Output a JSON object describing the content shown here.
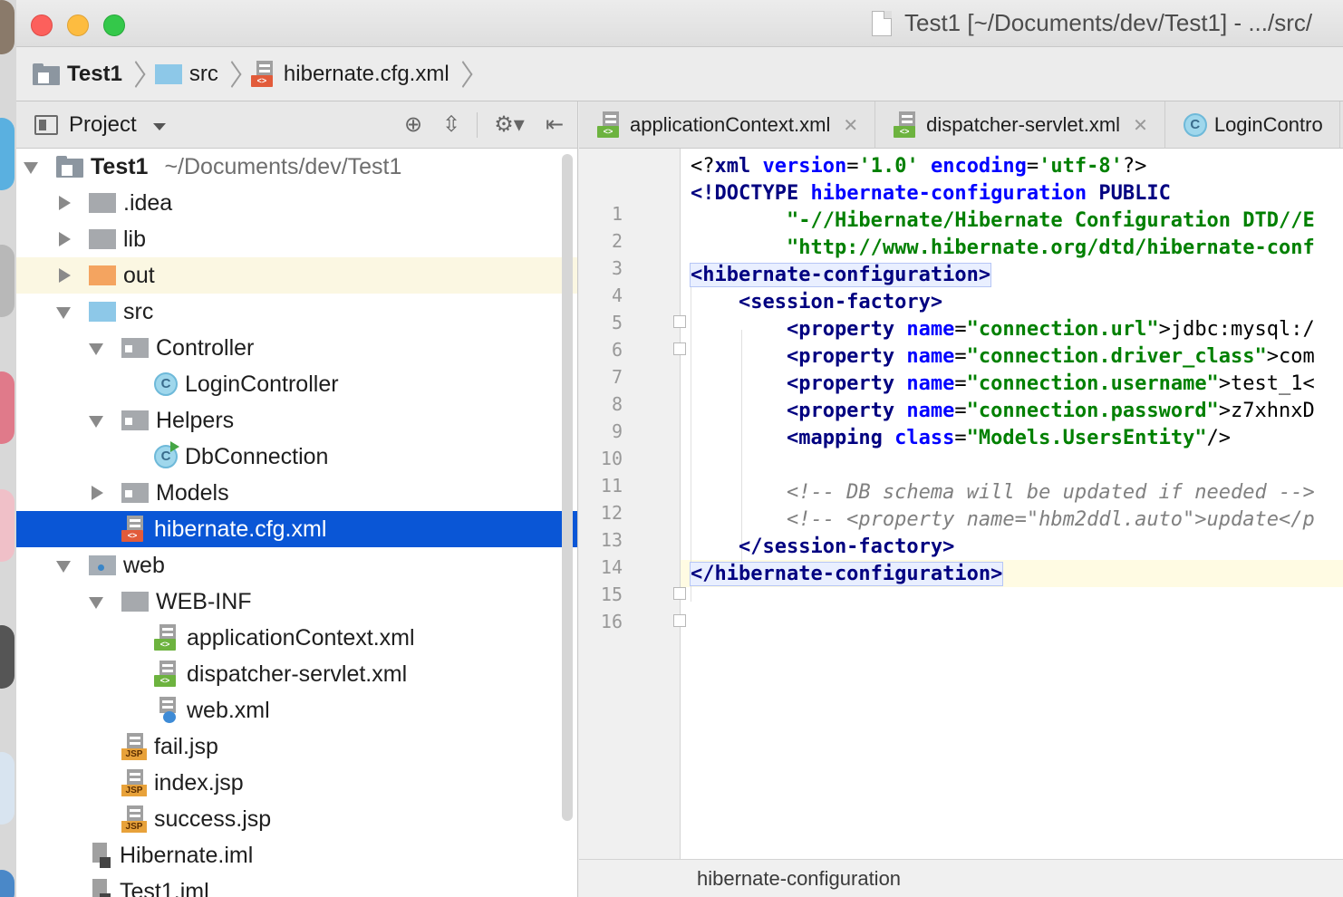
{
  "window": {
    "title": "Test1 [~/Documents/dev/Test1] - .../src/"
  },
  "breadcrumb": [
    {
      "label": "Test1",
      "icon": "module-icon"
    },
    {
      "label": "src",
      "icon": "folder-icon"
    },
    {
      "label": "hibernate.cfg.xml",
      "icon": "xml-file-icon"
    }
  ],
  "project_panel": {
    "title": "Project",
    "tools": [
      "locate-icon",
      "collapse-icon",
      "gear-icon",
      "hide-icon"
    ],
    "tree": [
      {
        "label": "Test1",
        "path": "~/Documents/dev/Test1",
        "depth": 0,
        "arrow": "down",
        "icon": "module"
      },
      {
        "label": ".idea",
        "depth": 1,
        "arrow": "right",
        "icon": "folder-gray"
      },
      {
        "label": "lib",
        "depth": 1,
        "arrow": "right",
        "icon": "folder-gray"
      },
      {
        "label": "out",
        "depth": 1,
        "arrow": "right",
        "icon": "folder-orange"
      },
      {
        "label": "src",
        "depth": 1,
        "arrow": "down",
        "icon": "folder-blue"
      },
      {
        "label": "Controller",
        "depth": 2,
        "arrow": "down",
        "icon": "package"
      },
      {
        "label": "LoginController",
        "depth": 3,
        "arrow": "none",
        "icon": "class"
      },
      {
        "label": "Helpers",
        "depth": 2,
        "arrow": "down",
        "icon": "package"
      },
      {
        "label": "DbConnection",
        "depth": 3,
        "arrow": "none",
        "icon": "class-run"
      },
      {
        "label": "Models",
        "depth": 2,
        "arrow": "right",
        "icon": "package"
      },
      {
        "label": "hibernate.cfg.xml",
        "depth": 2,
        "arrow": "none",
        "icon": "xml"
      },
      {
        "label": "web",
        "depth": 1,
        "arrow": "down",
        "icon": "web"
      },
      {
        "label": "WEB-INF",
        "depth": 2,
        "arrow": "down",
        "icon": "folder-gray"
      },
      {
        "label": "applicationContext.xml",
        "depth": 3,
        "arrow": "none",
        "icon": "spring-xml"
      },
      {
        "label": "dispatcher-servlet.xml",
        "depth": 3,
        "arrow": "none",
        "icon": "spring-xml"
      },
      {
        "label": "web.xml",
        "depth": 3,
        "arrow": "none",
        "icon": "web-xml"
      },
      {
        "label": "fail.jsp",
        "depth": 2,
        "arrow": "none",
        "icon": "jsp"
      },
      {
        "label": "index.jsp",
        "depth": 2,
        "arrow": "none",
        "icon": "jsp"
      },
      {
        "label": "success.jsp",
        "depth": 2,
        "arrow": "none",
        "icon": "jsp"
      },
      {
        "label": "Hibernate.iml",
        "depth": 1,
        "arrow": "none",
        "icon": "iml"
      },
      {
        "label": "Test1.iml",
        "depth": 1,
        "arrow": "none",
        "icon": "iml"
      }
    ],
    "selected": "hibernate.cfg.xml",
    "highlighted": "out"
  },
  "editor": {
    "tabs": [
      {
        "label": "applicationContext.xml",
        "icon": "spring-xml"
      },
      {
        "label": "dispatcher-servlet.xml",
        "icon": "spring-xml"
      },
      {
        "label": "LoginContro",
        "icon": "class"
      }
    ],
    "line_numbers": [
      "1",
      "2",
      "3",
      "4",
      "5",
      "6",
      "7",
      "8",
      "9",
      "10",
      "11",
      "12",
      "13",
      "14",
      "15",
      "16"
    ],
    "code": {
      "l1": {
        "a": "<?",
        "b": "xml",
        "c": " ",
        "d": "version",
        "e": "=",
        "f": "'1.0'",
        "g": " ",
        "h": "encoding",
        "i": "=",
        "j": "'utf-8'",
        "k": "?>"
      },
      "l2": {
        "a": "<!DOCTYPE ",
        "b": "hibernate-configuration",
        "c": " PUBLIC"
      },
      "l3": "        \"-//Hibernate/Hibernate Configuration DTD//E",
      "l4": "        \"http://www.hibernate.org/dtd/hibernate-conf",
      "l5": "<hibernate-configuration>",
      "l6": "    <session-factory>",
      "l7": {
        "tag": "        <property ",
        "attr": "name",
        "eq": "=",
        "val": "\"connection.url\"",
        "rest": ">jdbc:mysql:/"
      },
      "l8": {
        "tag": "        <property ",
        "attr": "name",
        "eq": "=",
        "val": "\"connection.driver_class\"",
        "rest": ">com"
      },
      "l9": {
        "tag": "        <property ",
        "attr": "name",
        "eq": "=",
        "val": "\"connection.username\"",
        "rest": ">test_1<"
      },
      "l10": {
        "tag": "        <property ",
        "attr": "name",
        "eq": "=",
        "val": "\"connection.password\"",
        "rest": ">z7xhnxD"
      },
      "l11": {
        "tag": "        <mapping ",
        "attr": "class",
        "eq": "=",
        "val": "\"Models.UsersEntity\"",
        "rest": "/>"
      },
      "l12": "",
      "l13": "        <!-- DB schema will be updated if needed -->",
      "l14": "        <!-- <property name=\"hbm2ddl.auto\">update</p",
      "l15": "    </session-factory>",
      "l16": "</hibernate-configuration>"
    },
    "status_breadcrumb": "hibernate-configuration"
  }
}
